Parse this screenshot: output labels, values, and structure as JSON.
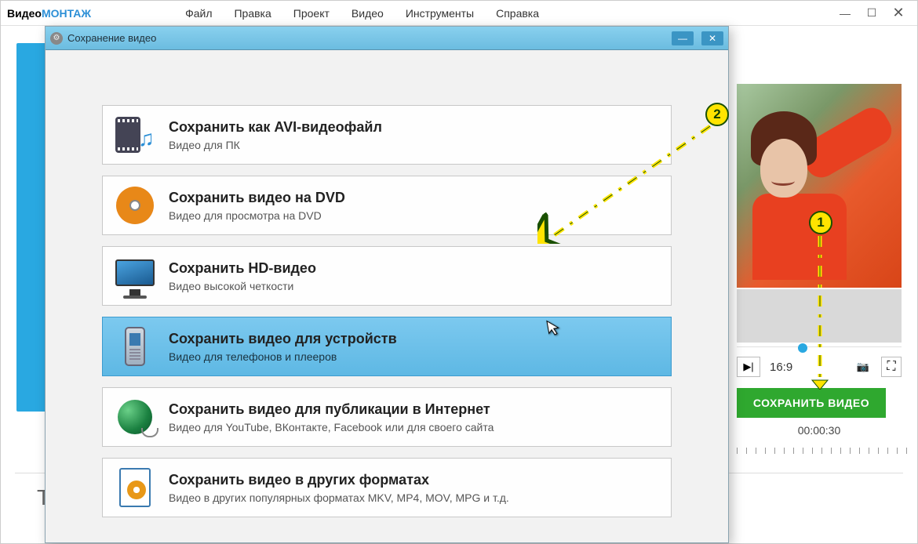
{
  "app": {
    "logo_part1": "Видео",
    "logo_part2": "МОНТАЖ",
    "menu": [
      "Файл",
      "Правка",
      "Проект",
      "Видео",
      "Инструменты",
      "Справка"
    ]
  },
  "win": {
    "min": "—",
    "max": "☐",
    "close": "✕"
  },
  "dialog": {
    "title": "Сохранение видео",
    "options": [
      {
        "title": "Сохранить как AVI-видеофайл",
        "desc": "Видео для ПК",
        "icon": "film-note-icon"
      },
      {
        "title": "Сохранить видео на DVD",
        "desc": "Видео для просмотра на DVD",
        "icon": "dvd-disc-icon"
      },
      {
        "title": "Сохранить HD-видео",
        "desc": "Видео высокой четкости",
        "icon": "monitor-icon"
      },
      {
        "title": "Сохранить видео для устройств",
        "desc": "Видео для телефонов и плееров",
        "icon": "phone-icon"
      },
      {
        "title": "Сохранить видео для публикации в Интернет",
        "desc": "Видео для YouTube, ВКонтакте, Facebook или для своего сайта",
        "icon": "globe-icon"
      },
      {
        "title": "Сохранить видео в других форматах",
        "desc": "Видео в других популярных форматах MKV, MP4, MOV, MPG и т.д.",
        "icon": "file-reel-icon"
      }
    ],
    "win": {
      "min": "—",
      "close": "✕"
    }
  },
  "player": {
    "aspect": "16:9",
    "next_glyph": "▶|",
    "camera_glyph": "📷",
    "fullscreen_glyph": "⛶"
  },
  "save_button": "СОХРАНИТЬ ВИДЕО",
  "timecode": "00:00:30",
  "markers": {
    "one": "1",
    "two": "2"
  },
  "timeline_label": "T"
}
